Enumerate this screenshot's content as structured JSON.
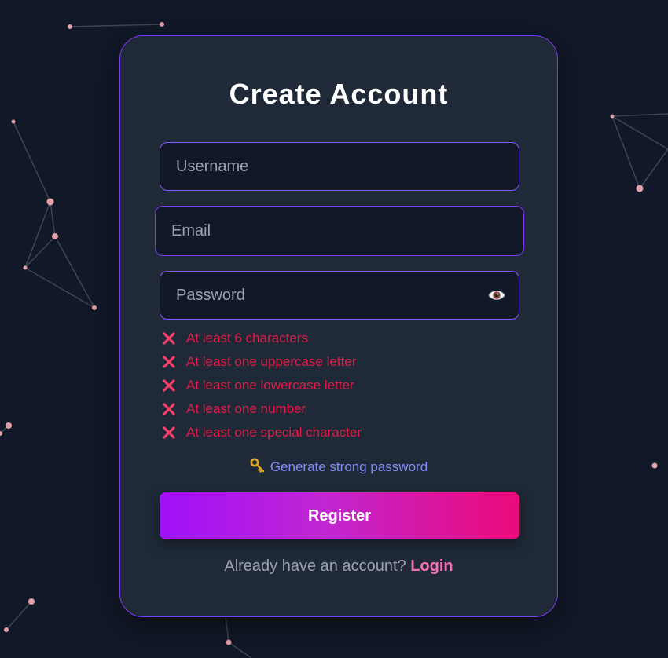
{
  "form": {
    "title": "Create Account",
    "username_placeholder": "Username",
    "email_placeholder": "Email",
    "password_placeholder": "Password",
    "rules": [
      "At least 6 characters",
      "At least one uppercase letter",
      "At least one lowercase letter",
      "At least one number",
      "At least one special character"
    ],
    "generate_label": "Generate strong password",
    "register_label": "Register",
    "login_prompt": "Already have an account?",
    "login_label": "Login"
  },
  "icons": {
    "toggle_password": "eye-icon",
    "rule_status": "cross-mark-icon",
    "generate": "key-icon"
  },
  "colors": {
    "background": "#111827",
    "card": "#1f2937",
    "border": "#8b5cf6",
    "rule_error": "#e11d48",
    "link": "#818cf8",
    "login": "#f472b6",
    "button_start": "#a010f8",
    "button_end": "#ec0a78"
  }
}
